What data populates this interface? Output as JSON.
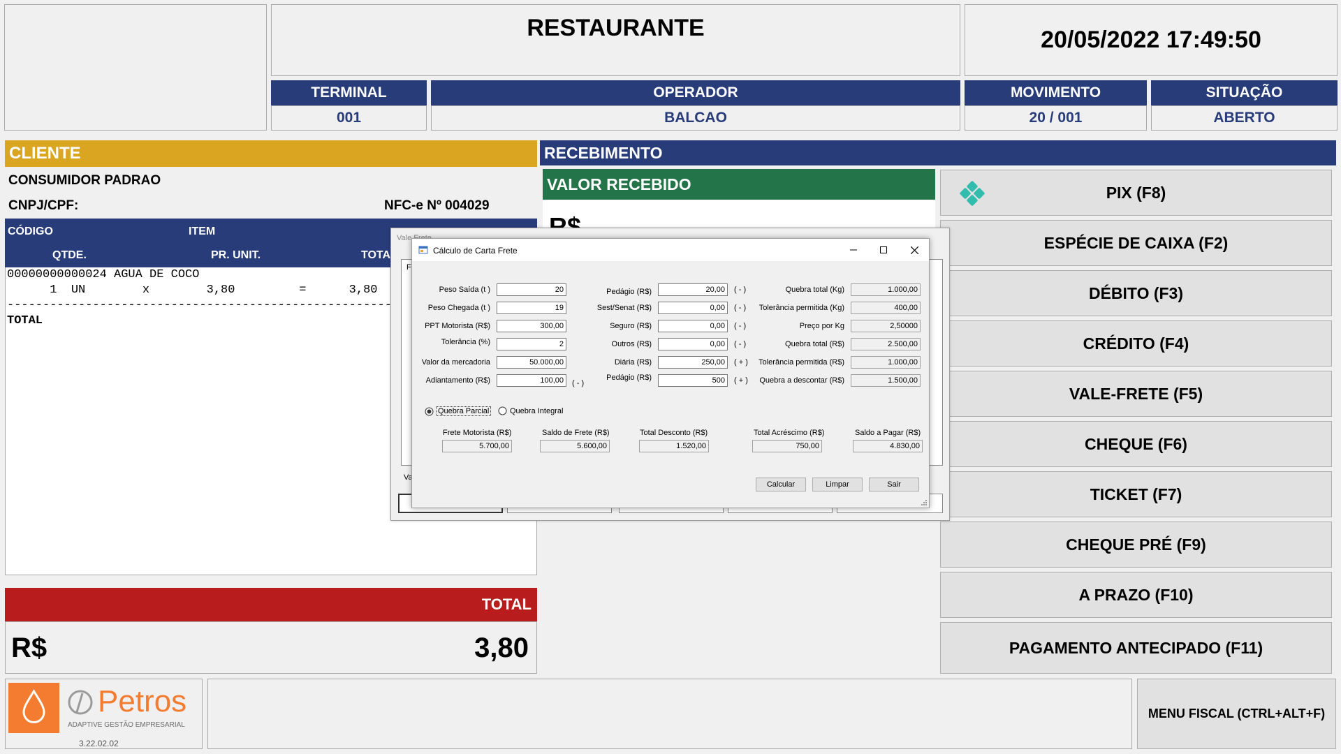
{
  "header": {
    "store_title": "RESTAURANTE",
    "datetime": "20/05/2022 17:49:50",
    "terminal": {
      "label": "TERMINAL",
      "value": "001"
    },
    "operador": {
      "label": "OPERADOR",
      "value": "BALCAO"
    },
    "movimento": {
      "label": "MOVIMENTO",
      "value": "20 / 001"
    },
    "situacao": {
      "label": "SITUAÇÃO",
      "value": "ABERTO"
    }
  },
  "cliente": {
    "title": "CLIENTE",
    "name": "CONSUMIDOR PADRAO",
    "cnpj_label": "CNPJ/CPF:",
    "nfce": "NFC-e Nº 004029",
    "columns": {
      "codigo": "CÓDIGO",
      "item": "ITEM",
      "qtde": "QTDE.",
      "pr_unit": "PR. UNIT.",
      "total": "TOTAL"
    },
    "receipt_line1": "00000000000024 AGUA DE COCO",
    "receipt_line2": "      1  UN        x        3,80         =      3,80",
    "receipt_sep": "------------------------------------------------------",
    "receipt_total": "TOTAL"
  },
  "total": {
    "title": "TOTAL",
    "currency": "R$",
    "value": "3,80"
  },
  "recebimento": {
    "title": "RECEBIMENTO",
    "valor_recebido": "VALOR RECEBIDO",
    "currency": "R$",
    "buttons": [
      "PIX (F8)",
      "ESPÉCIE DE CAIXA (F2)",
      "DÉBITO (F3)",
      "CRÉDITO (F4)",
      "VALE-FRETE (F5)",
      "CHEQUE (F6)",
      "TICKET (F7)",
      "CHEQUE PRÉ (F9)",
      "A PRAZO (F10)",
      "PAGAMENTO ANTECIPADO (F11)"
    ]
  },
  "footer": {
    "brand": "Petros",
    "tagline": "ADAPTIVE GESTÃO EMPRESARIAL",
    "version": "3.22.02.02",
    "menu_fiscal": "MENU FISCAL (CTRL+ALT+F)"
  },
  "vale_frete": {
    "title": "Vale Frete",
    "partial_f": "F",
    "partial_va": "Va"
  },
  "dialog": {
    "title": "Cálculo de Carta Frete",
    "left": [
      {
        "label": "Peso Saída (t )",
        "value": "20"
      },
      {
        "label": "Peso Chegada (t )",
        "value": "19"
      },
      {
        "label": "PPT Motorista (R$)",
        "value": "300,00"
      },
      {
        "label": "Tolerância (%)",
        "value": "2"
      },
      {
        "label": "Valor da mercadoria",
        "value": "50.000,00"
      },
      {
        "label": "Adiantamento (R$)",
        "value": "100,00",
        "sign": "( - )"
      }
    ],
    "middle": [
      {
        "label": "Pedágio (R$)",
        "value": "20,00",
        "sign": "( - )"
      },
      {
        "label": "Sest/Senat (R$)",
        "value": "0,00",
        "sign": "( - )"
      },
      {
        "label": "Seguro (R$)",
        "value": "0,00",
        "sign": "( - )"
      },
      {
        "label": "Outros (R$)",
        "value": "0,00",
        "sign": "( - )"
      },
      {
        "label": "Diária (R$)",
        "value": "250,00",
        "sign": "( + )"
      },
      {
        "label": "Pedágio (R$)",
        "value": "500",
        "sign": "( + )"
      }
    ],
    "right": [
      {
        "label": "Quebra total (Kg)",
        "value": "1.000,00"
      },
      {
        "label": "Tolerância permitida (Kg)",
        "value": "400,00"
      },
      {
        "label": "Preço por Kg",
        "value": "2,50000"
      },
      {
        "label": "Quebra total (R$)",
        "value": "2.500,00"
      },
      {
        "label": "Tolerância permitida (R$)",
        "value": "1.000,00"
      },
      {
        "label": "Quebra a descontar (R$)",
        "value": "1.500,00"
      }
    ],
    "radio_partial": "Quebra Parcial",
    "radio_integral": "Quebra Integral",
    "summary": [
      {
        "label": "Frete Motorista (R$)",
        "value": "5.700,00"
      },
      {
        "label": "Saldo de Frete (R$)",
        "value": "5.600,00"
      },
      {
        "label": "Total Desconto (R$)",
        "value": "1.520,00"
      },
      {
        "label": "Total Acréscimo (R$)",
        "value": "750,00"
      },
      {
        "label": "Saldo a Pagar (R$)",
        "value": "4.830,00"
      }
    ],
    "btn_calcular": "Calcular",
    "btn_limpar": "Limpar",
    "btn_sair": "Sair"
  },
  "colors": {
    "navy": "#283c7a",
    "gold": "#daa520",
    "green": "#237448",
    "red": "#b91c1c",
    "pix": "#32bcad",
    "petros_orange": "#f47c30"
  }
}
